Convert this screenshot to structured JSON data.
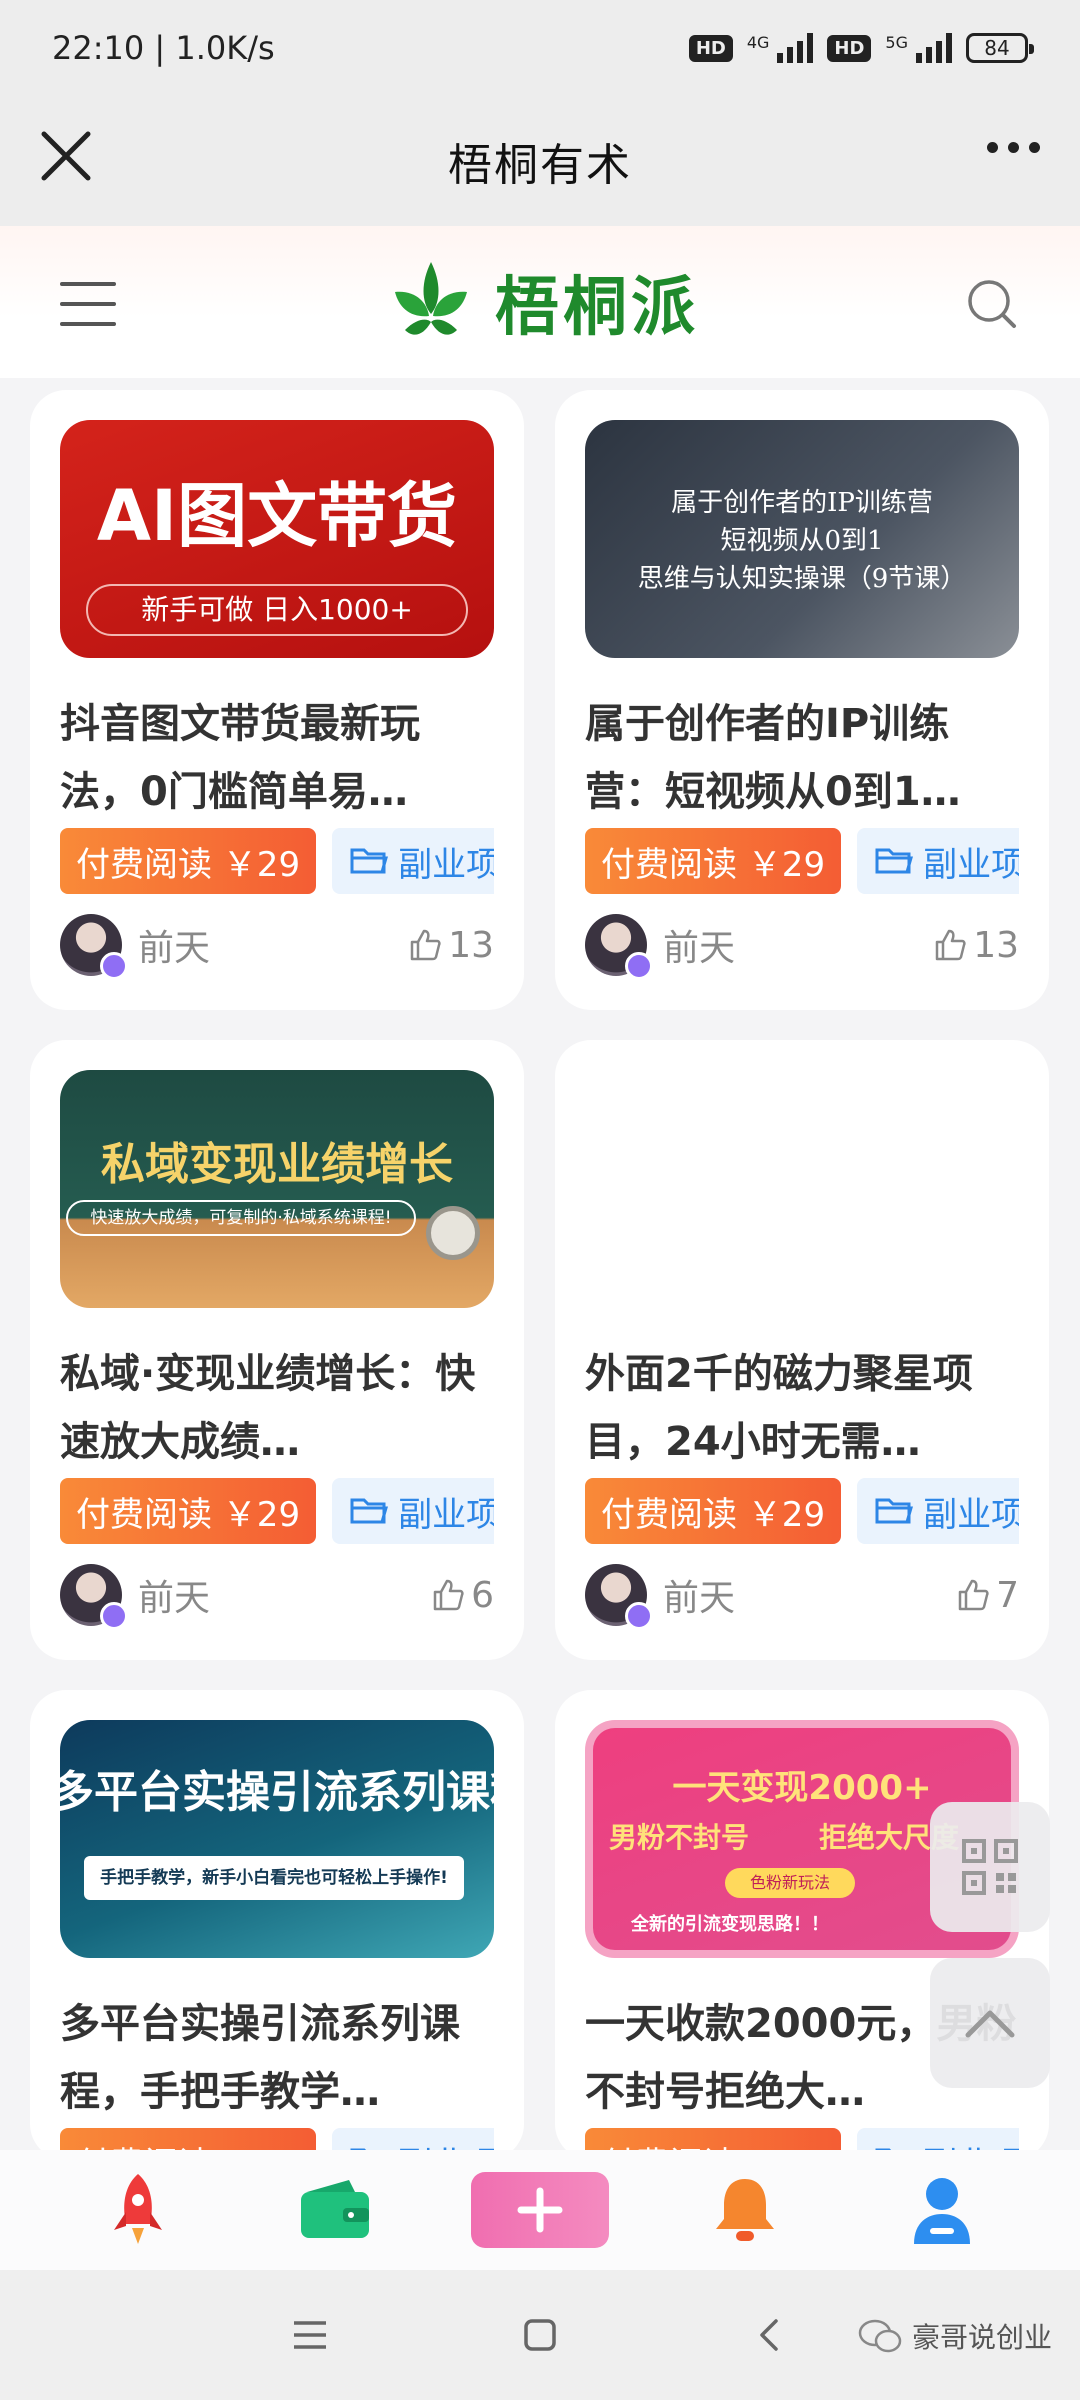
{
  "status_bar": {
    "time": "22:10 | 1.0K/s",
    "hd1": "HD",
    "net1": "4G",
    "hd2": "HD",
    "net2": "5G",
    "battery": "84"
  },
  "top_nav": {
    "title": "梧桐有术"
  },
  "site": {
    "logo_text": "梧桐派",
    "brand_color": "#1f8a2c"
  },
  "paid_label": "付费阅读 ￥29",
  "category_label": "副业项",
  "cards": [
    {
      "thumb_title": "AI图文带货",
      "thumb_sub": "新手可做 日入1000+",
      "title": "抖音图文带货最新玩法，0门槛简单易…",
      "time": "前天",
      "likes": "13"
    },
    {
      "thumb_title": "属于创作者的IP训练营",
      "thumb_line2": "短视频从0到1",
      "thumb_line3": "思维与认知实操课（9节课）",
      "title": "属于创作者的IP训练营：短视频从0到1…",
      "time": "前天",
      "likes": "13"
    },
    {
      "thumb_title": "私域变现业绩增长",
      "thumb_sub": "快速放大成绩，可复制的·私域系统课程!",
      "title": "私域·变现业绩增长：快速放大成绩…",
      "time": "前天",
      "likes": "6"
    },
    {
      "title": "外面2千的磁力聚星项目，24小时无需…",
      "time": "前天",
      "likes": "7"
    },
    {
      "thumb_title": "多平台实操引流系列课程",
      "thumb_sub": "手把手教学，新手小白看完也可轻松上手操作!",
      "title": "多平台实操引流系列课程，手把手教学…",
      "time": "",
      "likes": ""
    },
    {
      "thumb_title": "一天变现2000+",
      "thumb_line2": "男粉不封号",
      "thumb_line2b": "拒绝大尺度",
      "thumb_badge": "色粉新玩法",
      "thumb_sub": "全新的引流变现思路！！",
      "title": "一天收款2000元，男粉不封号拒绝大…",
      "time": "",
      "likes": ""
    }
  ],
  "watermark": "豪哥说创业"
}
